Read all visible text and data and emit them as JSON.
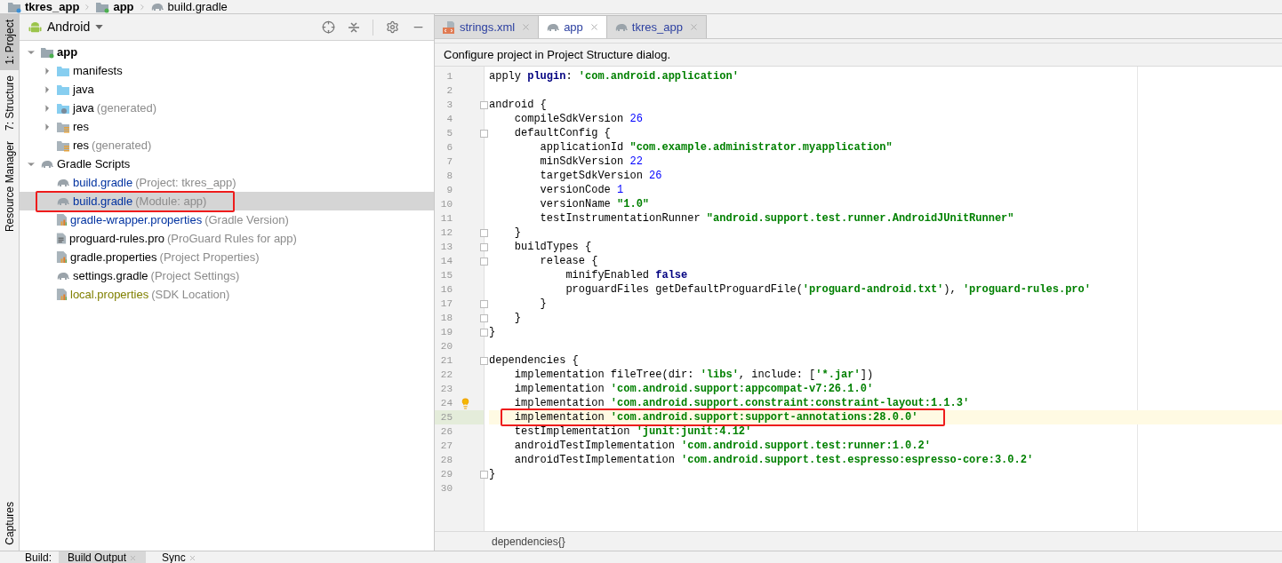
{
  "breadcrumb": [
    {
      "label": "tkres_app",
      "kind": "project"
    },
    {
      "label": "app",
      "kind": "module"
    },
    {
      "label": "build.gradle",
      "kind": "gradle"
    }
  ],
  "side_tabs": [
    {
      "label": "1: Project",
      "selected": true
    },
    {
      "label": "7: Structure",
      "selected": false
    },
    {
      "label": "Resource Manager",
      "selected": false
    },
    {
      "label": "Captures",
      "selected": false
    }
  ],
  "project_panel": {
    "view": "Android",
    "tree": [
      {
        "name": "app",
        "kind": "module",
        "bold": true,
        "expanded": true,
        "color": "#000000",
        "selected": false,
        "annotated": false,
        "children": [
          {
            "name": "manifests",
            "kind": "folder",
            "expanded": false,
            "color": "#000000",
            "selected": false,
            "annotated": false
          },
          {
            "name": "java",
            "kind": "folder",
            "expanded": false,
            "color": "#000000",
            "selected": false,
            "annotated": false
          },
          {
            "name": "java",
            "note": "(generated)",
            "kind": "folder-gen",
            "expanded": false,
            "color": "#000000",
            "selected": false,
            "annotated": false
          },
          {
            "name": "res",
            "kind": "res",
            "expanded": false,
            "color": "#000000",
            "selected": false,
            "annotated": false
          },
          {
            "name": "res",
            "note": "(generated)",
            "kind": "res",
            "color": "#000000",
            "selected": false,
            "annotated": false
          }
        ]
      },
      {
        "name": "Gradle Scripts",
        "kind": "gradle",
        "bold": false,
        "expanded": true,
        "color": "#000000",
        "selected": false,
        "annotated": false,
        "children": [
          {
            "name": "build.gradle",
            "note": "(Project: tkres_app)",
            "kind": "gradle",
            "color": "#0032a0",
            "selected": false,
            "annotated": false
          },
          {
            "name": "build.gradle",
            "note": "(Module: app)",
            "kind": "gradle",
            "color": "#0032a0",
            "selected": true,
            "annotated": true
          },
          {
            "name": "gradle-wrapper.properties",
            "note": "(Gradle Version)",
            "kind": "properties",
            "color": "#0032a0",
            "selected": false,
            "annotated": false
          },
          {
            "name": "proguard-rules.pro",
            "note": "(ProGuard Rules for app)",
            "kind": "text",
            "color": "#000000",
            "selected": false,
            "annotated": false
          },
          {
            "name": "gradle.properties",
            "note": "(Project Properties)",
            "kind": "properties",
            "color": "#000000",
            "selected": false,
            "annotated": false
          },
          {
            "name": "settings.gradle",
            "note": "(Project Settings)",
            "kind": "gradle",
            "color": "#000000",
            "selected": false,
            "annotated": false
          },
          {
            "name": "local.properties",
            "note": "(SDK Location)",
            "kind": "properties",
            "color": "#808000",
            "selected": false,
            "annotated": false
          }
        ]
      }
    ]
  },
  "editor_tabs": [
    {
      "label": "strings.xml",
      "kind": "xml",
      "selected": false
    },
    {
      "label": "app",
      "kind": "gradle",
      "selected": true
    },
    {
      "label": "tkres_app",
      "kind": "gradle",
      "selected": false
    }
  ],
  "banner": "Configure project in Project Structure dialog.",
  "code_lines": [
    {
      "number": "1",
      "tokens": [
        {
          "kind": "plain",
          "text": "apply "
        },
        {
          "kind": "keyword",
          "text": "plugin"
        },
        {
          "kind": "plain",
          "text": ": "
        },
        {
          "kind": "string",
          "text": "'com.android.application'"
        }
      ]
    },
    {
      "number": "2"
    },
    {
      "number": "3",
      "fold": true,
      "tokens": [
        {
          "kind": "plain",
          "text": "android {"
        }
      ]
    },
    {
      "number": "4",
      "tokens": [
        {
          "kind": "plain",
          "text": "    compileSdkVersion "
        },
        {
          "kind": "number",
          "text": "26"
        }
      ]
    },
    {
      "number": "5",
      "fold": true,
      "tokens": [
        {
          "kind": "plain",
          "text": "    defaultConfig {"
        }
      ]
    },
    {
      "number": "6",
      "tokens": [
        {
          "kind": "plain",
          "text": "        applicationId "
        },
        {
          "kind": "string",
          "text": "\"com.example.administrator.myapplication\""
        }
      ]
    },
    {
      "number": "7",
      "tokens": [
        {
          "kind": "plain",
          "text": "        minSdkVersion "
        },
        {
          "kind": "number",
          "text": "22"
        }
      ]
    },
    {
      "number": "8",
      "tokens": [
        {
          "kind": "plain",
          "text": "        targetSdkVersion "
        },
        {
          "kind": "number",
          "text": "26"
        }
      ]
    },
    {
      "number": "9",
      "tokens": [
        {
          "kind": "plain",
          "text": "        versionCode "
        },
        {
          "kind": "number",
          "text": "1"
        }
      ]
    },
    {
      "number": "10",
      "tokens": [
        {
          "kind": "plain",
          "text": "        versionName "
        },
        {
          "kind": "string",
          "text": "\"1.0\""
        }
      ]
    },
    {
      "number": "11",
      "tokens": [
        {
          "kind": "plain",
          "text": "        testInstrumentationRunner "
        },
        {
          "kind": "string",
          "text": "\"android.support.test.runner.AndroidJUnitRunner\""
        }
      ]
    },
    {
      "number": "12",
      "fold": true,
      "tokens": [
        {
          "kind": "plain",
          "text": "    }"
        }
      ]
    },
    {
      "number": "13",
      "fold": true,
      "tokens": [
        {
          "kind": "plain",
          "text": "    buildTypes {"
        }
      ]
    },
    {
      "number": "14",
      "fold": true,
      "tokens": [
        {
          "kind": "plain",
          "text": "        release {"
        }
      ]
    },
    {
      "number": "15",
      "tokens": [
        {
          "kind": "plain",
          "text": "            minifyEnabled "
        },
        {
          "kind": "keyword",
          "text": "false"
        }
      ]
    },
    {
      "number": "16",
      "tokens": [
        {
          "kind": "plain",
          "text": "            proguardFiles getDefaultProguardFile("
        },
        {
          "kind": "string",
          "text": "'proguard-android.txt'"
        },
        {
          "kind": "plain",
          "text": "), "
        },
        {
          "kind": "string",
          "text": "'proguard-rules.pro'"
        }
      ]
    },
    {
      "number": "17",
      "fold": true,
      "tokens": [
        {
          "kind": "plain",
          "text": "        }"
        }
      ]
    },
    {
      "number": "18",
      "fold": true,
      "tokens": [
        {
          "kind": "plain",
          "text": "    }"
        }
      ]
    },
    {
      "number": "19",
      "fold": true,
      "tokens": [
        {
          "kind": "plain",
          "text": "}"
        }
      ]
    },
    {
      "number": "20"
    },
    {
      "number": "21",
      "fold": true,
      "tokens": [
        {
          "kind": "plain",
          "text": "dependencies {"
        }
      ]
    },
    {
      "number": "22",
      "tokens": [
        {
          "kind": "plain",
          "text": "    implementation fileTree(dir: "
        },
        {
          "kind": "string",
          "text": "'libs'"
        },
        {
          "kind": "plain",
          "text": ", include: ["
        },
        {
          "kind": "string",
          "text": "'*.jar'"
        },
        {
          "kind": "plain",
          "text": "])"
        }
      ]
    },
    {
      "number": "23",
      "tokens": [
        {
          "kind": "plain",
          "text": "    implementation "
        },
        {
          "kind": "string",
          "text": "'com.android.support:appcompat-v7:26.1.0'"
        }
      ]
    },
    {
      "number": "24",
      "bulb": true,
      "tokens": [
        {
          "kind": "plain",
          "text": "    implementation "
        },
        {
          "kind": "string",
          "text": "'com.android.support.constraint:constraint-layout:1.1.3'"
        }
      ]
    },
    {
      "number": "25",
      "current": true,
      "annotated": true,
      "tokens": [
        {
          "kind": "plain",
          "text": "    implementation "
        },
        {
          "kind": "string",
          "text": "'com.android.support:support-annotations:28.0.0'"
        }
      ]
    },
    {
      "number": "26",
      "tokens": [
        {
          "kind": "plain",
          "text": "    testImplementation "
        },
        {
          "kind": "string",
          "text": "'junit:junit:4.12'"
        }
      ]
    },
    {
      "number": "27",
      "tokens": [
        {
          "kind": "plain",
          "text": "    androidTestImplementation "
        },
        {
          "kind": "string",
          "text": "'com.android.support.test:runner:1.0.2'"
        }
      ]
    },
    {
      "number": "28",
      "tokens": [
        {
          "kind": "plain",
          "text": "    androidTestImplementation "
        },
        {
          "kind": "string",
          "text": "'com.android.support.test.espresso:espresso-core:3.0.2'"
        }
      ]
    },
    {
      "number": "29",
      "fold": true,
      "tokens": [
        {
          "kind": "plain",
          "text": "}"
        }
      ]
    },
    {
      "number": "30"
    }
  ],
  "editor_breadcrumb": "dependencies{}",
  "bottom_bar": {
    "label": "Build:",
    "tabs": [
      {
        "label": "Build Output",
        "selected": true
      },
      {
        "label": "Sync",
        "selected": false
      }
    ]
  }
}
